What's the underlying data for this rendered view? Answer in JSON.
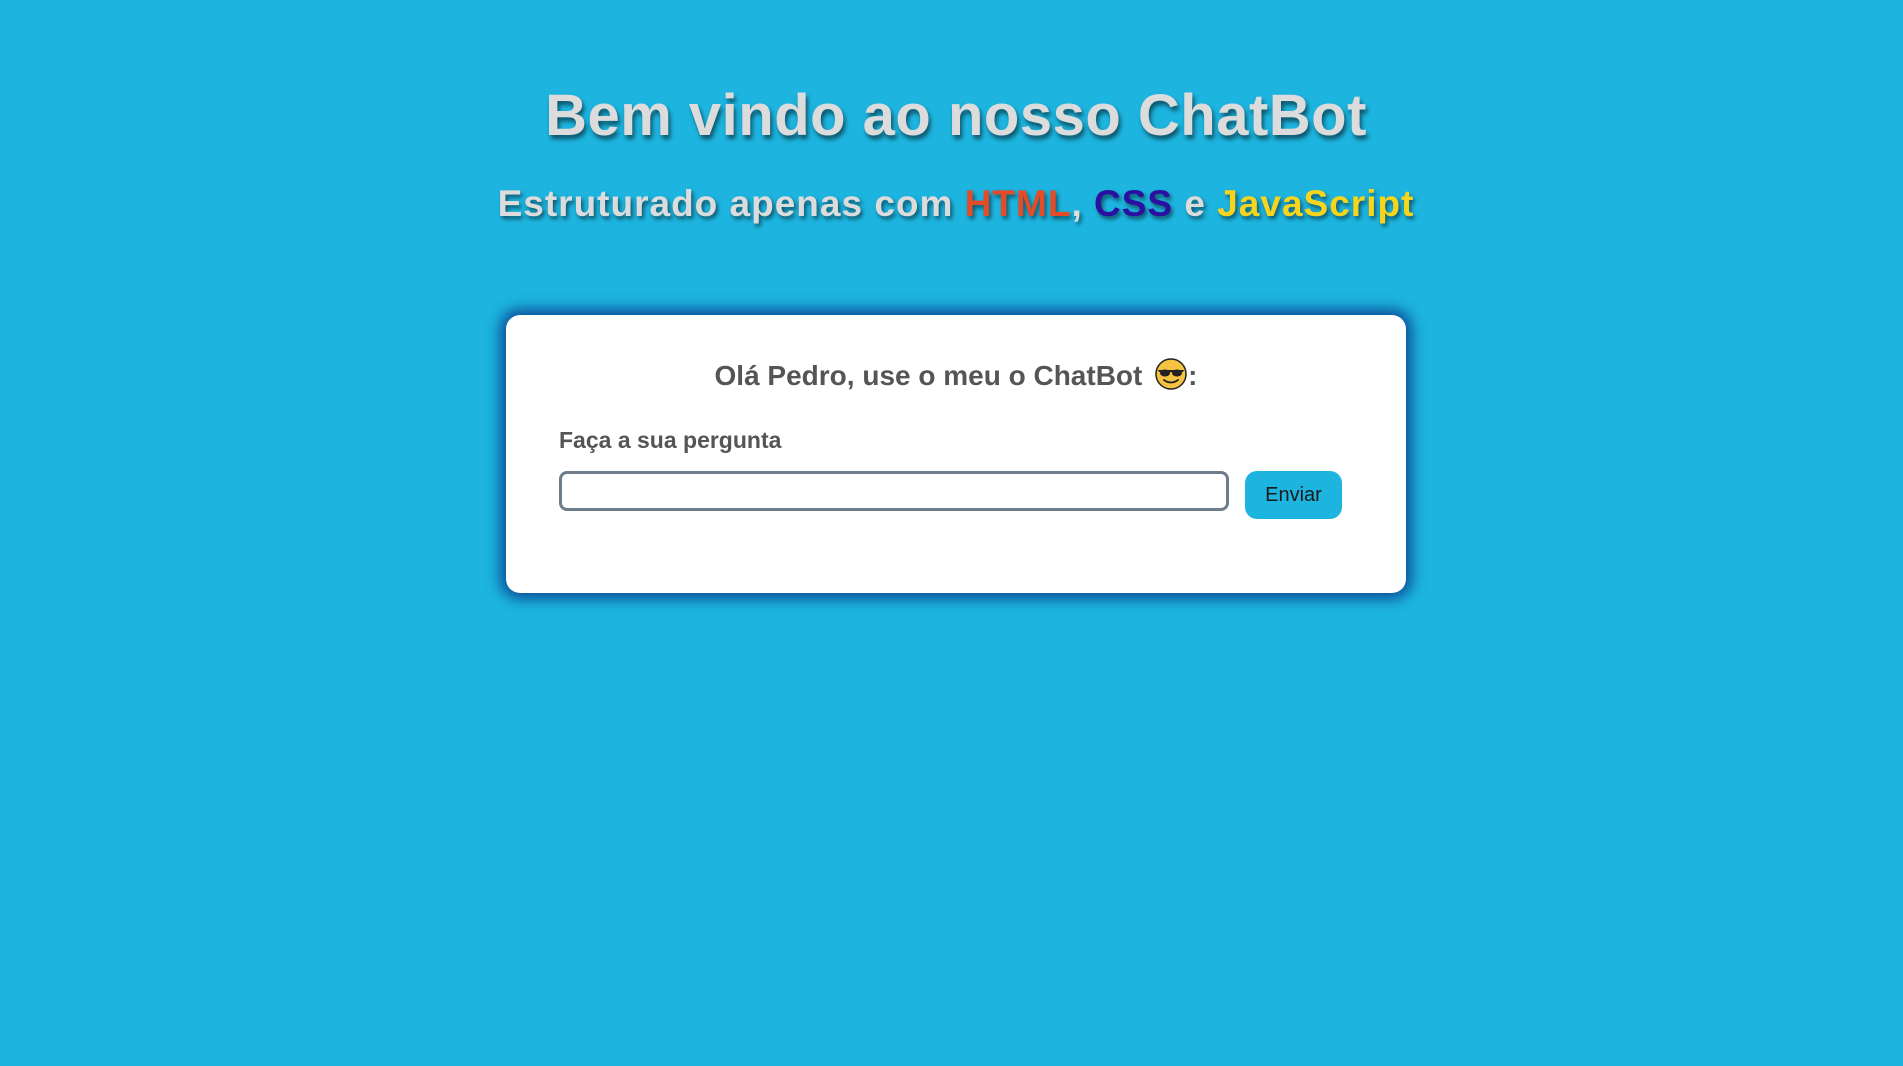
{
  "header": {
    "title": "Bem vindo ao nosso ChatBot",
    "subtitle_prefix": "Estruturado apenas com ",
    "tech_html": "HTML",
    "comma": ",",
    "tech_css": "CSS",
    "and": "e",
    "tech_js": "JavaScript"
  },
  "colors": {
    "background": "#1db5e0",
    "html": "#e34c26",
    "css": "#2a0fa0",
    "javascript": "#f7d51d",
    "button": "#1db5e0"
  },
  "chat": {
    "greeting": "Olá Pedro, use o meu o ChatBot",
    "greeting_icon": "smiling-face-with-sunglasses-icon",
    "greeting_suffix": ":",
    "question_label": "Faça a sua pergunta",
    "input_value": "",
    "send_label": "Enviar"
  }
}
